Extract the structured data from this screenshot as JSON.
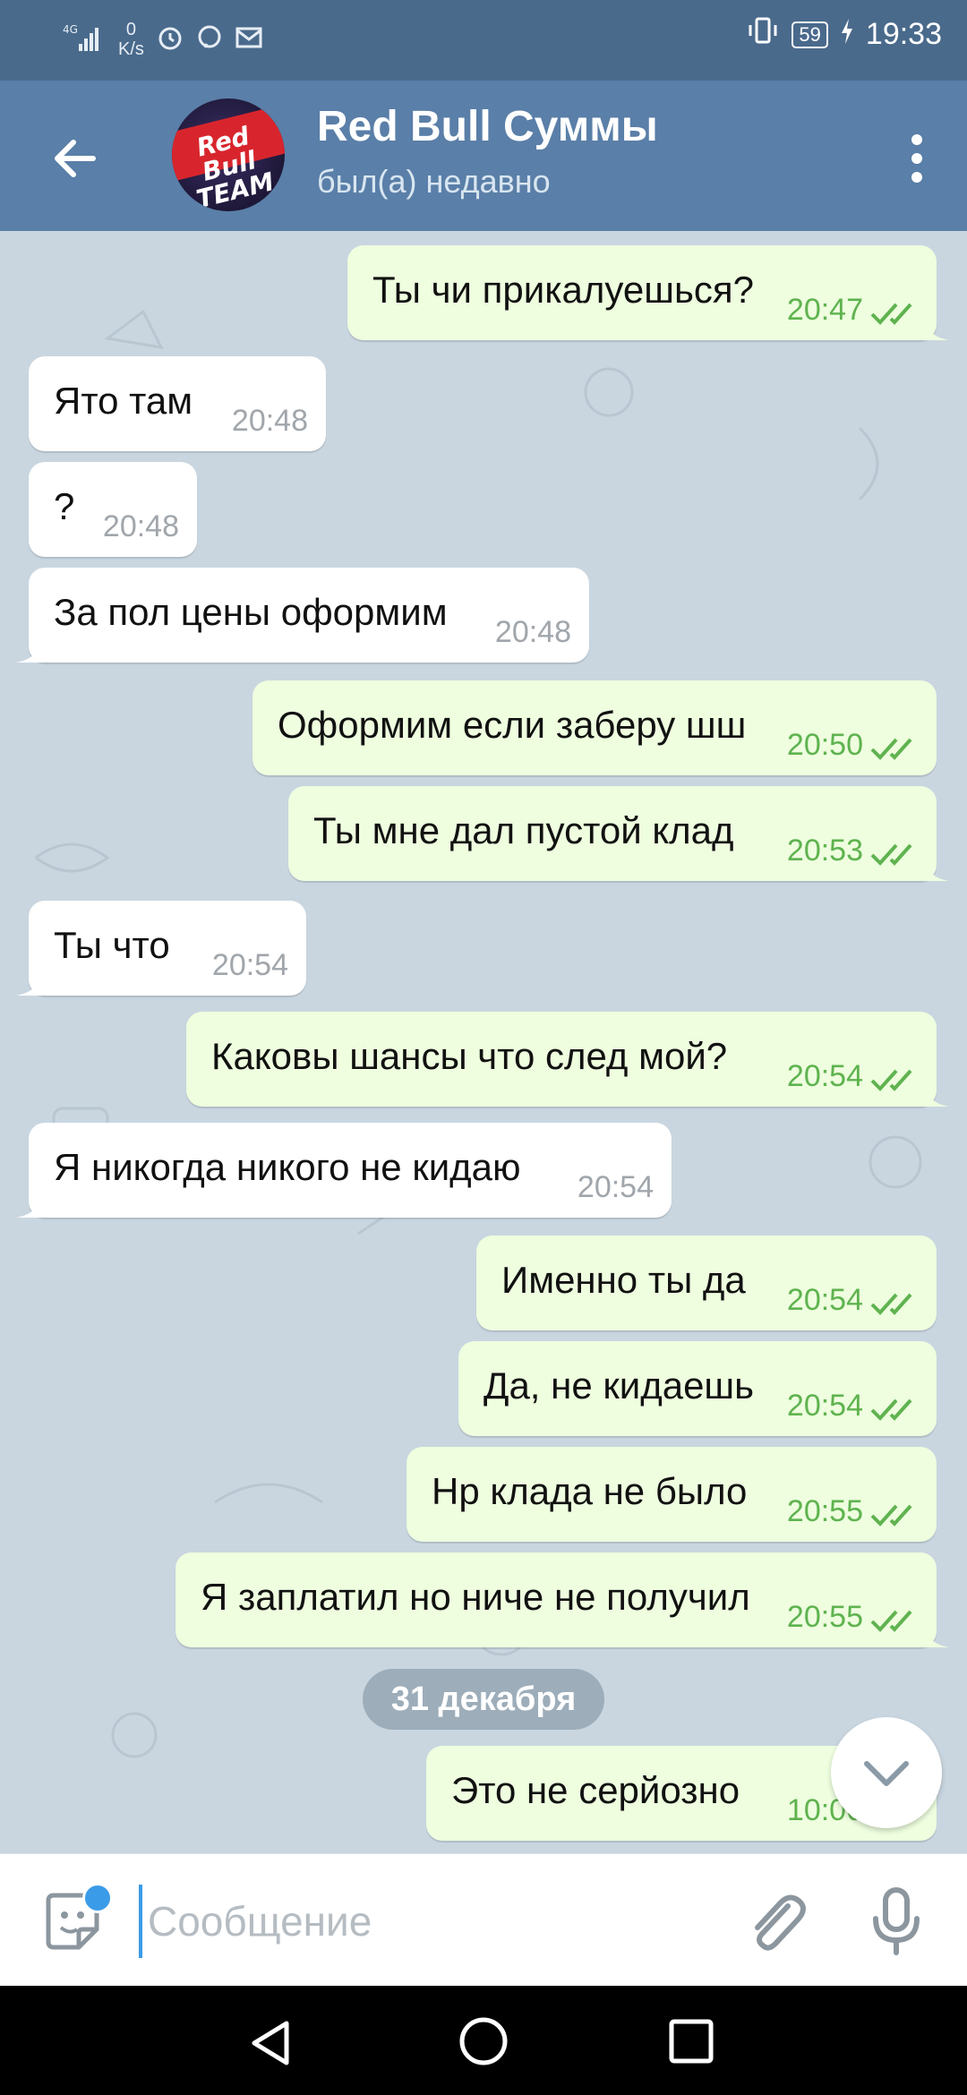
{
  "status_bar": {
    "network": "4G",
    "net_speed_value": "0",
    "net_speed_unit": "K/s",
    "battery": "59",
    "time": "19:33"
  },
  "header": {
    "avatar_text": "Red Bull TEAM",
    "title": "Red Bull Суммы",
    "subtitle": "был(а) недавно"
  },
  "messages": [
    {
      "dir": "out",
      "text": "Ты чи прикалуешься?",
      "time": "20:47"
    },
    {
      "dir": "in",
      "text": "Ято там",
      "time": "20:48"
    },
    {
      "dir": "in",
      "text": "?",
      "time": "20:48"
    },
    {
      "dir": "in",
      "text": "За пол цены оформим",
      "time": "20:48"
    },
    {
      "dir": "out",
      "text": "Оформим если заберу шш",
      "time": "20:50"
    },
    {
      "dir": "out",
      "text": "Ты мне дал пустой клад",
      "time": "20:53"
    },
    {
      "dir": "in",
      "text": "Ты что",
      "time": "20:54"
    },
    {
      "dir": "out",
      "text": "Каковы шансы что след мой?",
      "time": "20:54"
    },
    {
      "dir": "in",
      "text": "Я никогда никого не кидаю",
      "time": "20:54"
    },
    {
      "dir": "out",
      "text": "Именно ты да",
      "time": "20:54"
    },
    {
      "dir": "out",
      "text": "Да, не кидаешь",
      "time": "20:54"
    },
    {
      "dir": "out",
      "text": "Нр клада не было",
      "time": "20:55"
    },
    {
      "dir": "out",
      "text": "Я заплатил но ниче не получил",
      "time": "20:55"
    },
    {
      "dir": "out",
      "text": "Это не серйозно",
      "time": "10:06"
    }
  ],
  "date_divider": "31 декабря",
  "composer": {
    "placeholder": "Сообщение"
  },
  "colors": {
    "header_bg": "#5a7fa8",
    "status_bg": "#4a6a8c",
    "chat_bg": "#c9d6e0",
    "incoming_bubble": "#ffffff",
    "outgoing_bubble": "#eefedf",
    "read_ticks": "#5fb34f",
    "accent": "#3a9be8"
  },
  "icons": {
    "back": "arrow-left-icon",
    "menu": "more-vertical-icon",
    "emoji": "sticker-icon",
    "attach": "paperclip-icon",
    "mic": "microphone-icon",
    "scroll_down": "chevron-down-icon"
  }
}
